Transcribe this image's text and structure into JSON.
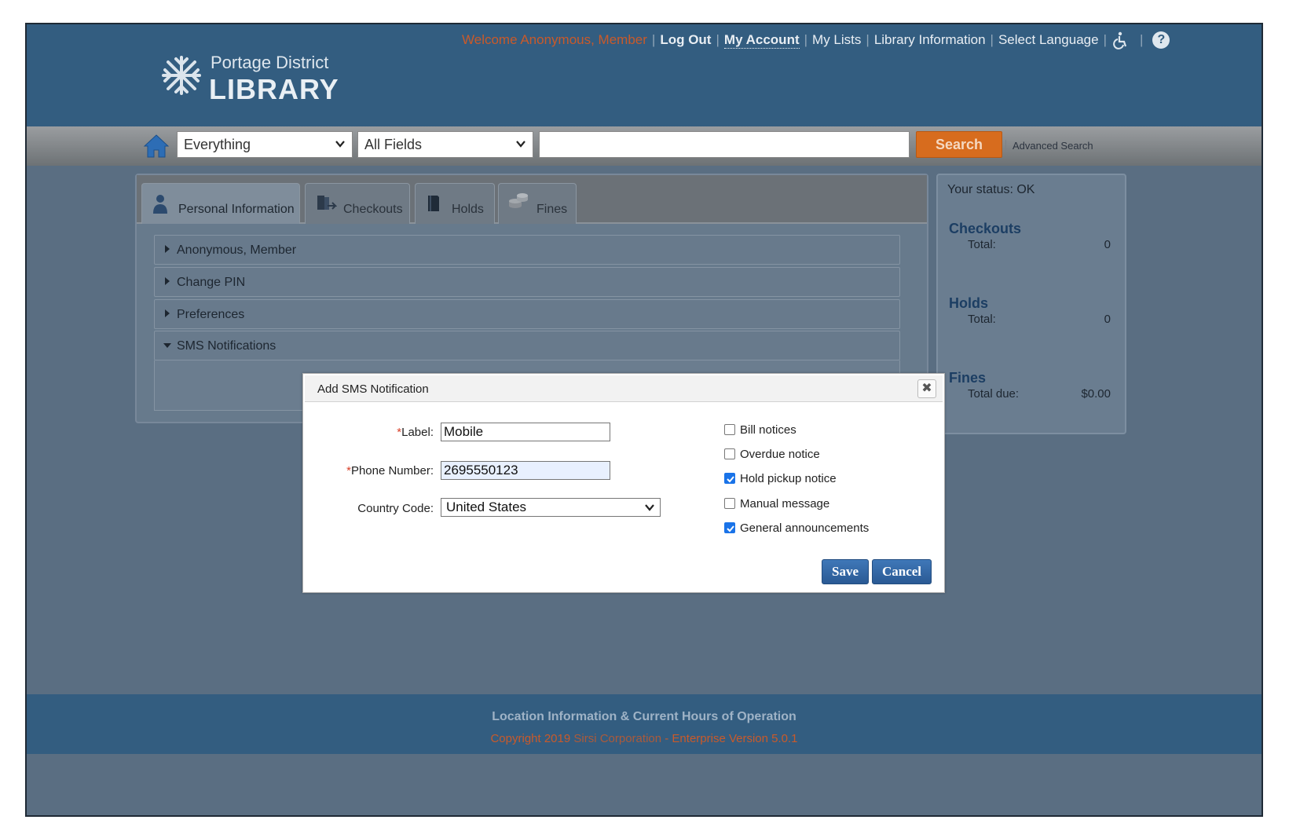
{
  "library": {
    "name_line1": "Portage District",
    "name_line2": "LIBRARY"
  },
  "topnav": {
    "welcome": "Welcome Anonymous, Member",
    "logout": "Log Out",
    "my_account": "My Account",
    "my_lists": "My Lists",
    "library_information": "Library Information",
    "select_language": "Select Language",
    "accessibility_icon": "wheelchair-icon",
    "help_icon": "question-circle-icon"
  },
  "search": {
    "scope": "Everything",
    "field": "All Fields",
    "query": "",
    "button": "Search",
    "advanced": "Advanced Search"
  },
  "tabs": [
    {
      "label": "Personal Information",
      "icon": "person-icon",
      "active": true
    },
    {
      "label": "Checkouts",
      "icon": "books-icon",
      "active": false
    },
    {
      "label": "Holds",
      "icon": "book-icon",
      "active": false
    },
    {
      "label": "Fines",
      "icon": "coins-icon",
      "active": false
    }
  ],
  "accordion": [
    {
      "label": "Anonymous, Member",
      "expanded": false
    },
    {
      "label": "Change PIN",
      "expanded": false
    },
    {
      "label": "Preferences",
      "expanded": false
    },
    {
      "label": "SMS Notifications",
      "expanded": true
    }
  ],
  "status": {
    "label": "Your status: OK",
    "checkouts_title": "Checkouts",
    "checkouts_total_label": "Total:",
    "checkouts_total": "0",
    "holds_title": "Holds",
    "holds_total_label": "Total:",
    "holds_total": "0",
    "fines_title": "Fines",
    "fines_total_label": "Total due:",
    "fines_total": "$0.00"
  },
  "footer": {
    "hours": "Location Information & Current Hours of Operation",
    "copyright_prefix": "Copyright 2019 ",
    "company": "Sirsi Corporation",
    "version": " - Enterprise Version 5.0.1"
  },
  "modal": {
    "title": "Add SMS Notification",
    "close_icon": "close-icon",
    "required_mark": "*",
    "label_label": "Label:",
    "label_value": "Mobile",
    "phone_label": "Phone Number:",
    "phone_value": "2695550123",
    "country_label": "Country Code:",
    "country_value": "United States",
    "checkboxes": [
      {
        "label": "Bill notices",
        "checked": false
      },
      {
        "label": "Overdue notice",
        "checked": false
      },
      {
        "label": "Hold pickup notice",
        "checked": true
      },
      {
        "label": "Manual message",
        "checked": false
      },
      {
        "label": "General announcements",
        "checked": true
      }
    ],
    "save": "Save",
    "cancel": "Cancel"
  },
  "colors": {
    "header_blue": "#335d80",
    "accent_orange": "#d76c1e",
    "button_blue": "#2a5a94",
    "checkbox_blue": "#1a73e8"
  }
}
